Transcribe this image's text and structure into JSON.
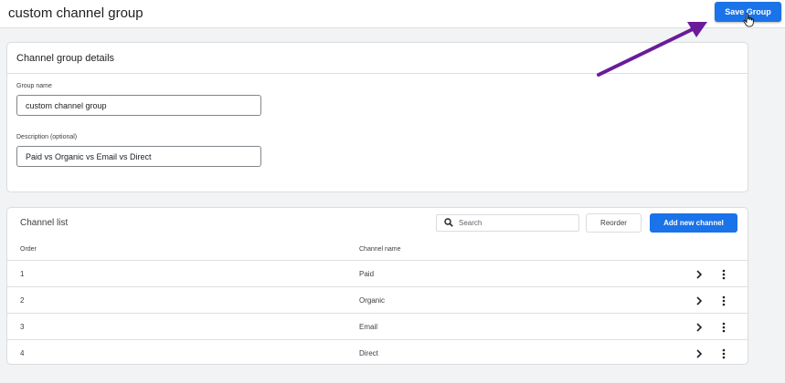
{
  "header": {
    "title": "custom channel group",
    "save_label": "Save Group"
  },
  "details": {
    "heading": "Channel group details",
    "group_name_label": "Group name",
    "group_name_value": "custom channel group",
    "description_label": "Description (optional)",
    "description_value": "Paid vs Organic vs Email vs Direct"
  },
  "channel_list": {
    "heading": "Channel list",
    "search_placeholder": "Search",
    "reorder_label": "Reorder",
    "add_label": "Add new channel",
    "columns": {
      "order": "Order",
      "name": "Channel name"
    },
    "rows": [
      {
        "order": "1",
        "name": "Paid"
      },
      {
        "order": "2",
        "name": "Organic"
      },
      {
        "order": "3",
        "name": "Email"
      },
      {
        "order": "4",
        "name": "Direct"
      }
    ]
  },
  "colors": {
    "accent": "#1a73e8",
    "annotation_arrow": "#6a1b9a"
  }
}
